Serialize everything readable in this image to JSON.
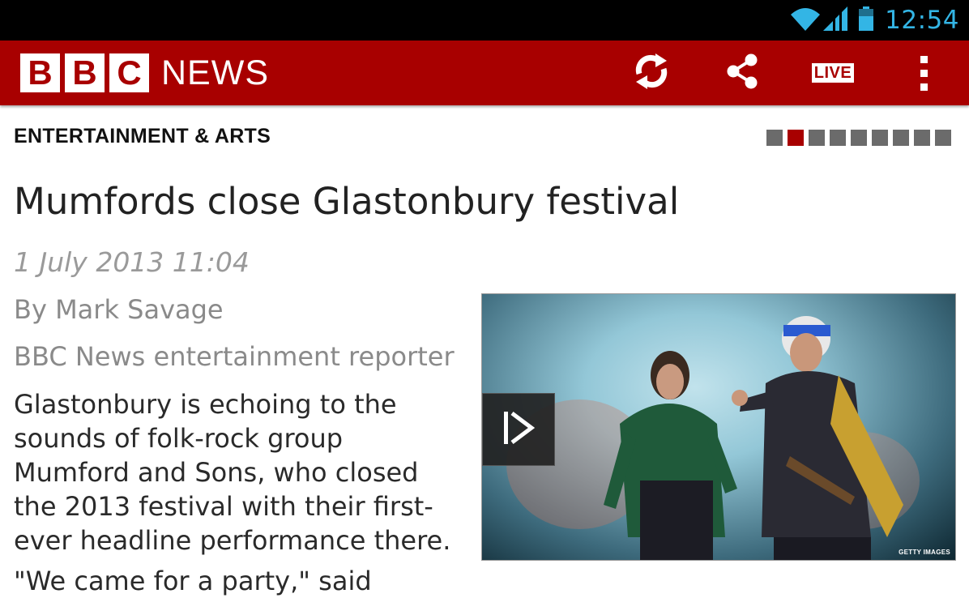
{
  "status_bar": {
    "time": "12:54",
    "icons": [
      "wifi-icon",
      "signal-icon",
      "battery-icon"
    ],
    "time_color": "#33b5e5"
  },
  "action_bar": {
    "logo_letters": [
      "B",
      "B",
      "C"
    ],
    "logo_word": "NEWS",
    "live_label": "LIVE",
    "actions": [
      "refresh-icon",
      "share-icon",
      "live-badge",
      "overflow-menu-icon"
    ],
    "brand_color": "#a80000"
  },
  "article": {
    "section": "ENTERTAINMENT & ARTS",
    "page_count": 9,
    "current_page": 2,
    "headline": "Mumfords close Glastonbury festival",
    "date": "1 July 2013 11:04",
    "byline": "By Mark Savage",
    "role": "BBC News entertainment reporter",
    "paragraph_lines": [
      "Glastonbury is echoing to the",
      "sounds of folk-rock group",
      "Mumford and Sons, who closed",
      "the 2013 festival with their first-",
      "ever headline performance there."
    ],
    "next_paragraph_start": "\"We came for a party,\" said",
    "image": {
      "credit": "GETTY IMAGES",
      "has_video": true
    }
  }
}
